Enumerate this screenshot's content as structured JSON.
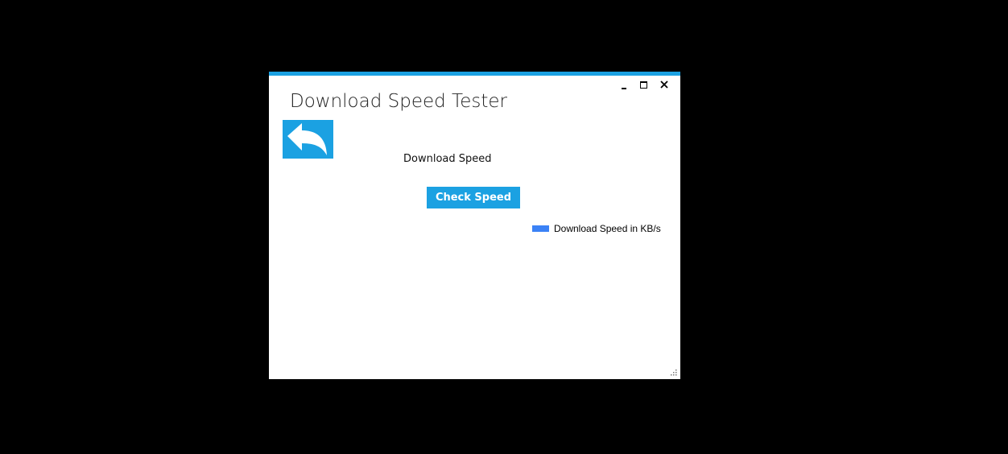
{
  "window": {
    "title": "Download Speed Tester",
    "accent_color": "#1ba1e2"
  },
  "title_bar": {
    "minimize_icon": "minimize-icon",
    "maximize_icon": "maximize-icon",
    "close_icon": "close-icon",
    "close_glyph": "✕"
  },
  "main": {
    "back_icon": "back-arrow-icon",
    "speed_label": "Download Speed",
    "check_button_label": "Check Speed"
  },
  "chart_data": {
    "type": "bar",
    "series": [
      {
        "name": "Download Speed in KB/s",
        "color": "#3b82f6",
        "values": []
      }
    ],
    "legend": "top-right"
  }
}
